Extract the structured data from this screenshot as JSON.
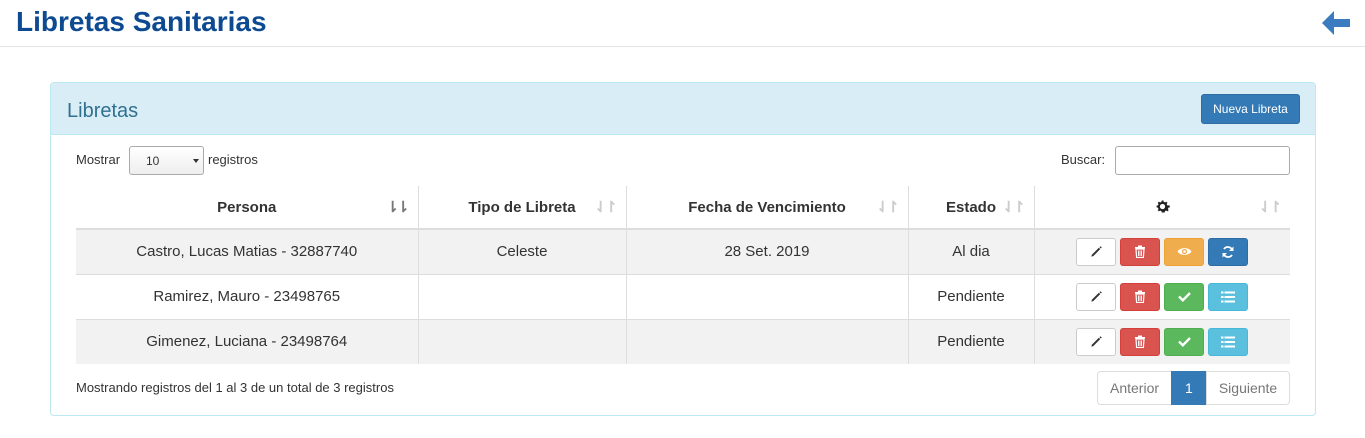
{
  "header": {
    "title": "Libretas Sanitarias",
    "back_icon": "arrow-left-icon"
  },
  "panel": {
    "title": "Libretas",
    "new_button": "Nueva Libreta"
  },
  "controls": {
    "show_label": "Mostrar",
    "page_size": "10",
    "records_label": "registros",
    "search_label": "Buscar:",
    "search_value": ""
  },
  "table": {
    "columns": [
      "Persona",
      "Tipo de Libreta",
      "Fecha de Vencimiento",
      "Estado",
      ""
    ],
    "actions_header_icon": "gear-icon",
    "rows": [
      {
        "persona": "Castro, Lucas Matias - 32887740",
        "tipo": "Celeste",
        "fecha": "28 Set. 2019",
        "estado": "Al dia",
        "actions": [
          "edit",
          "delete",
          "view",
          "renew"
        ]
      },
      {
        "persona": "Ramirez, Mauro - 23498765",
        "tipo": "",
        "fecha": "",
        "estado": "Pendiente",
        "actions": [
          "edit",
          "delete",
          "approve",
          "list"
        ]
      },
      {
        "persona": "Gimenez, Luciana - 23498764",
        "tipo": "",
        "fecha": "",
        "estado": "Pendiente",
        "actions": [
          "edit",
          "delete",
          "approve",
          "list"
        ]
      }
    ]
  },
  "footer": {
    "info": "Mostrando registros del 1 al 3 de un total de 3 registros",
    "prev": "Anterior",
    "page": "1",
    "next": "Siguiente"
  },
  "colors": {
    "primary": "#337ab7",
    "danger": "#d9534f",
    "warning": "#f0ad4e",
    "success": "#5cb85c",
    "info": "#5bc0de",
    "title": "#0d4a91"
  }
}
